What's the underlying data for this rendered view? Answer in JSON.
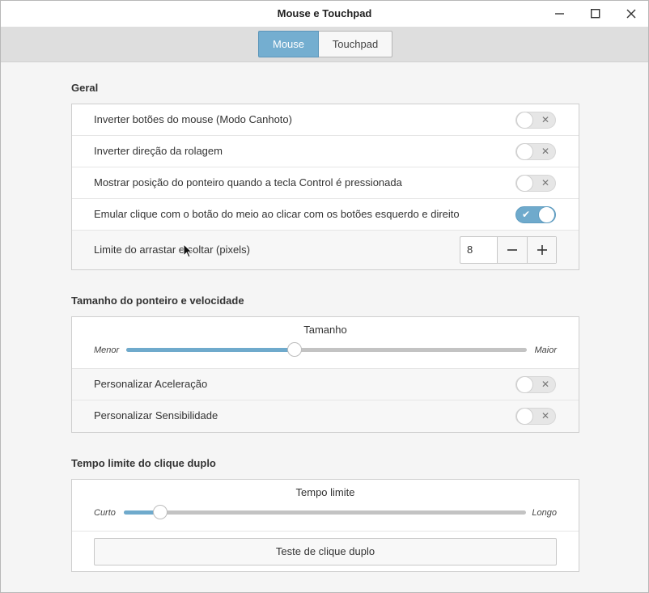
{
  "window": {
    "title": "Mouse e Touchpad"
  },
  "tabs": [
    {
      "label": "Mouse",
      "active": true
    },
    {
      "label": "Touchpad",
      "active": false
    }
  ],
  "geral": {
    "title": "Geral",
    "rows": [
      {
        "label": "Inverter botões do mouse (Modo Canhoto)",
        "enabled": false
      },
      {
        "label": "Inverter direção da rolagem",
        "enabled": false
      },
      {
        "label": "Mostrar posição do ponteiro quando a tecla Control é pressionada",
        "enabled": false
      },
      {
        "label": "Emular clique com o botão do meio ao clicar com os botões esquerdo e direito",
        "enabled": true
      }
    ],
    "drag": {
      "label": "Limite do arrastar e soltar (pixels)",
      "value": "8"
    }
  },
  "pointer": {
    "title": "Tamanho do ponteiro e velocidade",
    "slider": {
      "title": "Tamanho",
      "min_label": "Menor",
      "max_label": "Maior",
      "level": 0.42
    },
    "rows": [
      {
        "label": "Personalizar Aceleração",
        "enabled": false
      },
      {
        "label": "Personalizar Sensibilidade",
        "enabled": false
      }
    ]
  },
  "doubleclick": {
    "title": "Tempo limite do clique duplo",
    "slider": {
      "title": "Tempo limite",
      "min_label": "Curto",
      "max_label": "Longo",
      "level": 0.09
    },
    "test_button": "Teste de clique duplo"
  },
  "colors": {
    "accent": "#74aed0",
    "toggle_on": "#6faacc",
    "tabbar": "#dedede"
  }
}
